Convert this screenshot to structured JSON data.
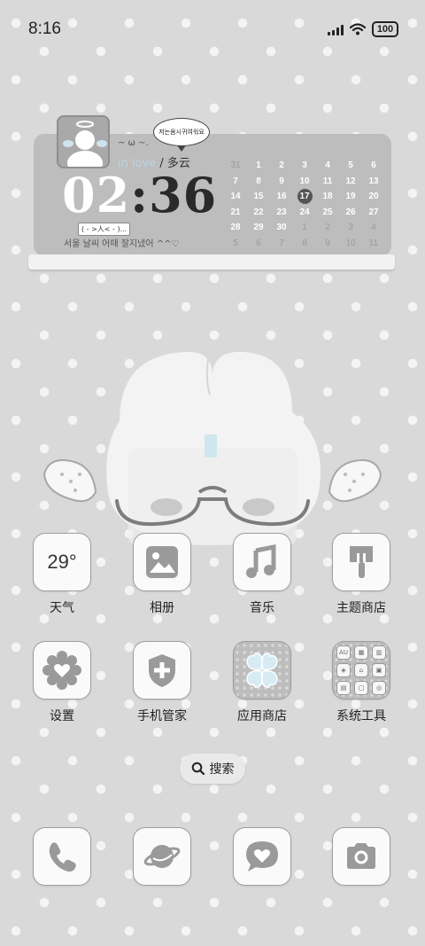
{
  "status_bar": {
    "time": "8:16",
    "battery": "100"
  },
  "widget": {
    "bubble_text": "저는옴시귀여워요",
    "kaomoji": "~ ω ~.",
    "love_text": "in love",
    "separator": " / ",
    "weather": "多云",
    "clock_hour": "02",
    "clock_colon": ":",
    "clock_minute": "36",
    "chip_text": "( - >人< - )...",
    "korean_text": "서울 날씨 어때 잘지냈어 ^^♡",
    "calendar": {
      "rows": [
        [
          "31",
          "1",
          "2",
          "3",
          "4",
          "5",
          "6"
        ],
        [
          "7",
          "8",
          "9",
          "10",
          "11",
          "12",
          "13"
        ],
        [
          "14",
          "15",
          "16",
          "17",
          "18",
          "19",
          "20"
        ],
        [
          "21",
          "22",
          "23",
          "24",
          "25",
          "26",
          "27"
        ],
        [
          "28",
          "29",
          "30",
          "1",
          "2",
          "3",
          "4"
        ],
        [
          "5",
          "6",
          "7",
          "8",
          "9",
          "10",
          "11"
        ]
      ],
      "today": "17"
    }
  },
  "apps": {
    "row1": [
      {
        "label": "天气",
        "icon": "weather-icon",
        "temp": "29°"
      },
      {
        "label": "相册",
        "icon": "photo-icon"
      },
      {
        "label": "音乐",
        "icon": "music-note-icon"
      },
      {
        "label": "主题商店",
        "icon": "paint-brush-icon"
      }
    ],
    "row2": [
      {
        "label": "设置",
        "icon": "gear-heart-icon"
      },
      {
        "label": "手机管家",
        "icon": "shield-plus-icon"
      },
      {
        "label": "应用商店",
        "icon": "clover-icon"
      },
      {
        "label": "系统工具",
        "icon": "folder-icon",
        "folder_tiles": [
          "AU",
          "▦",
          "▥",
          "◈",
          "⌂",
          "▣",
          "▤",
          "▢",
          "◎"
        ]
      }
    ]
  },
  "search": {
    "label": "搜索"
  },
  "dock": [
    {
      "icon": "phone-icon"
    },
    {
      "icon": "planet-icon"
    },
    {
      "icon": "message-heart-icon"
    },
    {
      "icon": "camera-icon"
    }
  ],
  "colors": {
    "background": "#d9d9d9",
    "dots": "#f4f4f4",
    "widget": "#bdbdbd",
    "icon_gray": "#9e9e9e",
    "accent_blue": "#bcd2e2"
  }
}
